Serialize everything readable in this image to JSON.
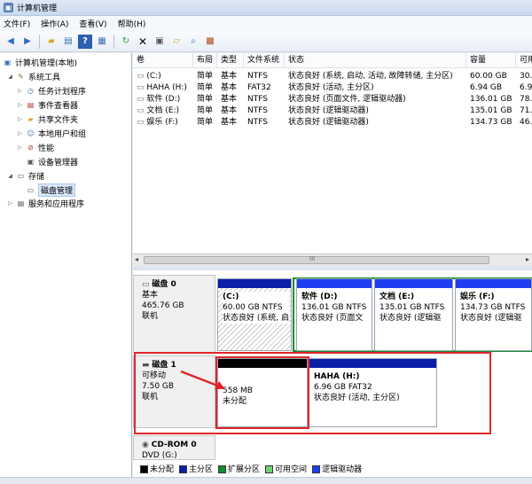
{
  "window": {
    "title": "计算机管理"
  },
  "menu": [
    "文件(F)",
    "操作(A)",
    "查看(V)",
    "帮助(H)"
  ],
  "tree": {
    "root": "计算机管理(本地)",
    "system_tools": "系统工具",
    "task_scheduler": "任务计划程序",
    "event_viewer": "事件查看器",
    "shared_folders": "共享文件夹",
    "local_users": "本地用户和组",
    "performance": "性能",
    "device_manager": "设备管理器",
    "storage": "存储",
    "disk_management": "磁盘管理",
    "services_apps": "服务和应用程序"
  },
  "columns": [
    "卷",
    "布局",
    "类型",
    "文件系统",
    "状态",
    "容量",
    "可用"
  ],
  "volumes": [
    {
      "name": "(C:)",
      "layout": "简单",
      "type": "基本",
      "fs": "NTFS",
      "status": "状态良好 (系统, 启动, 活动, 故障转储, 主分区)",
      "capacity": "60.00 GB",
      "free": "30."
    },
    {
      "name": "HAHA (H:)",
      "layout": "简单",
      "type": "基本",
      "fs": "FAT32",
      "status": "状态良好 (活动, 主分区)",
      "capacity": "6.94 GB",
      "free": "6.9"
    },
    {
      "name": "软件 (D:)",
      "layout": "简单",
      "type": "基本",
      "fs": "NTFS",
      "status": "状态良好 (页面文件, 逻辑驱动器)",
      "capacity": "136.01 GB",
      "free": "78."
    },
    {
      "name": "文档 (E:)",
      "layout": "简单",
      "type": "基本",
      "fs": "NTFS",
      "status": "状态良好 (逻辑驱动器)",
      "capacity": "135.01 GB",
      "free": "71."
    },
    {
      "name": "娱乐 (F:)",
      "layout": "简单",
      "type": "基本",
      "fs": "NTFS",
      "status": "状态良好 (逻辑驱动器)",
      "capacity": "134.73 GB",
      "free": "46."
    }
  ],
  "scroll_marker": "III",
  "disk0": {
    "name": "磁盘 0",
    "type": "基本",
    "size": "465.76 GB",
    "state": "联机",
    "c": {
      "label": "(C:)",
      "size": "60.00 GB NTFS",
      "status": "状态良好 (系统, 启"
    },
    "d": {
      "label": "软件 (D:)",
      "size": "136.01 GB NTFS",
      "status": "状态良好 (页面文"
    },
    "e": {
      "label": "文档 (E:)",
      "size": "135.01 GB NTFS",
      "status": "状态良好 (逻辑驱"
    },
    "f": {
      "label": "娱乐 (F:)",
      "size": "134.73 GB NTFS",
      "status": "状态良好 (逻辑驱"
    }
  },
  "disk1": {
    "name": "磁盘 1",
    "type": "可移动",
    "size": "7.50 GB",
    "state": "联机",
    "unalloc": {
      "size": "558 MB",
      "label": "未分配"
    },
    "h": {
      "label": "HAHA (H:)",
      "size": "6.96 GB FAT32",
      "status": "状态良好 (活动, 主分区)"
    }
  },
  "cdrom": {
    "name": "CD-ROM 0",
    "drive": "DVD (G:)"
  },
  "legend": [
    "未分配",
    "主分区",
    "扩展分区",
    "可用空间",
    "逻辑驱动器"
  ],
  "colors": {
    "primary": "#0a1fa8",
    "logical": "#1f3ef0",
    "extended": "#118f2b",
    "free": "#6fd36f",
    "unallocated": "#000000",
    "highlight": "#e0262b"
  }
}
